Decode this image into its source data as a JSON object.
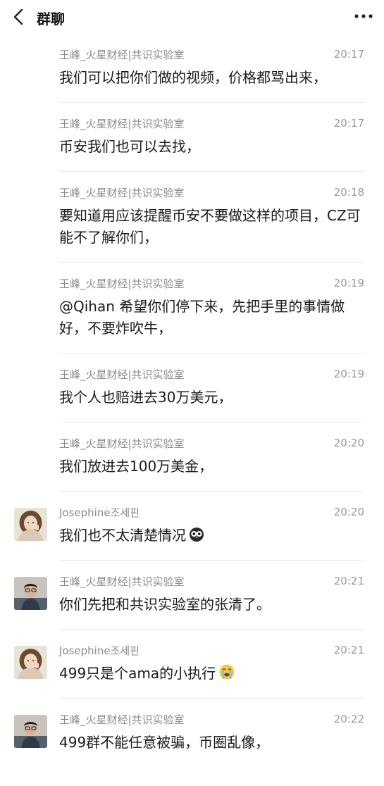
{
  "header": {
    "title": "群聊",
    "back_icon": "chevron-left-icon",
    "more_icon": "more-horizontal-icon"
  },
  "messages": [
    {
      "sender": "王峰_火星财经|共识实验室",
      "time": "20:17",
      "text": "我们可以把你们做的视频，价格都骂出来，",
      "avatar": false
    },
    {
      "sender": "王峰_火星财经|共识实验室",
      "time": "20:17",
      "text": "币安我们也可以去找，",
      "avatar": false
    },
    {
      "sender": "王峰_火星财经|共识实验室",
      "time": "20:18",
      "text": "要知道用应该提醒币安不要做这样的项目，CZ可能不了解你们，",
      "avatar": false
    },
    {
      "sender": "王峰_火星财经|共识实验室",
      "time": "20:19",
      "text": "@Qihan 希望你们停下来，先把手里的事情做好，不要炸吹牛，",
      "avatar": false
    },
    {
      "sender": "王峰_火星财经|共识实验室",
      "time": "20:19",
      "text": "我个人也赔进去30万美元，",
      "avatar": false
    },
    {
      "sender": "王峰_火星财经|共识实验室",
      "time": "20:20",
      "text": "我们放进去100万美金，",
      "avatar": false
    },
    {
      "sender": "Josephine조세핀",
      "time": "20:20",
      "text": "我们也不太清楚情况",
      "avatar": "woman-avatar",
      "emoji": "owl-emoji"
    },
    {
      "sender": "王峰_火星财经|共识实验室",
      "time": "20:21",
      "text": "你们先把和共识实验室的张清了。",
      "avatar": "man-avatar"
    },
    {
      "sender": "Josephine조세핀",
      "time": "20:21",
      "text": "499只是个ama的小执行",
      "avatar": "woman-avatar",
      "emoji": "crying-face-emoji"
    },
    {
      "sender": "王峰_火星财经|共识实验室",
      "time": "20:22",
      "text": "499群不能任意被骗，币圈乱像，",
      "avatar": "man-avatar"
    }
  ]
}
